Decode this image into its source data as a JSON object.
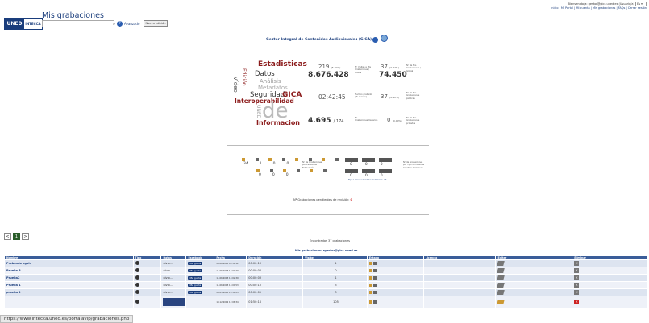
{
  "header": {
    "logo_uned": "UNED",
    "logo_intecca": "INTECCA",
    "app_title": "Mis grabaciones",
    "search_placeholder": "",
    "advanced_label": "Avanzado",
    "new_recording_label": "Nueva edición",
    "welcome": "Bienvenido/a: gestor@gicc.uned.es (Usuario/a)",
    "lang": "Es",
    "nav": "Inicio | Mi Portal | Mi cuenta | Mis grabaciones | FAQs | Cerrar sesión"
  },
  "gica": {
    "title": "Gestor Integral de Contenidos Audiovisuales (GICA)"
  },
  "cloud": [
    {
      "text": "Estadisticas",
      "color": "#8b1a1a"
    },
    {
      "text": "Datos",
      "color": "#333"
    },
    {
      "text": "Análisis",
      "color": "#999"
    },
    {
      "text": "Metadatos",
      "color": "#aaa"
    },
    {
      "text": "Seguridad",
      "color": "#333"
    },
    {
      "text": "GICA",
      "color": "#8b1a1a"
    },
    {
      "text": "Interoperabilidad",
      "color": "#8b1a1a"
    },
    {
      "text": "de",
      "color": "#bbb"
    },
    {
      "text": "Informacion",
      "color": "#8b1a1a"
    },
    {
      "text": "Vídeo",
      "color": "#555"
    },
    {
      "text": "Edición",
      "color": "#8b1a1a"
    },
    {
      "text": "UNED",
      "color": "#999"
    }
  ],
  "stats": {
    "s1": {
      "value": "219",
      "unit": "(5.20%)",
      "label": "Nº Visitas a Mis Grabaciones / Global"
    },
    "s2": {
      "value": "8.676.428",
      "label": ""
    },
    "s3": {
      "value": "37",
      "unit": "(0.42%)",
      "label": "Nº de Mis Grabaciones / Global"
    },
    "s4": {
      "value": "74.450",
      "label": ""
    },
    "s5": {
      "value": "02:42:45",
      "label": "Tiempo grabado (Mi cuenta)"
    },
    "s6": {
      "value": "37",
      "unit": "(0.42%)",
      "label": "Nº de Mis Grabaciones públicas"
    },
    "s7": {
      "value": "4.695",
      "unit": "/ 174",
      "label": "Nº Grabaciones/Usuarios"
    },
    "s8": {
      "value": "0",
      "unit": "(0.00%)",
      "label": "Nº de Mis Grabaciones privadas"
    }
  },
  "states": {
    "row1": [
      "34",
      "1",
      "0",
      "0"
    ],
    "row2": [
      "0",
      "0",
      "0"
    ],
    "label": "Nº de Grabaciones por Estado de Fabricación",
    "cc_row1": [
      "0",
      "0",
      "0"
    ],
    "cc_row2": [
      "0",
      "0",
      "0"
    ],
    "cc_label": "Nº de Grabaciones por Tipo de Licencia Creative Commons",
    "cc_note": "Tipo Licencia Creative Commons: 37",
    "pending": "Nº Grabaciones pendientes de revisión:",
    "pending_value": "0"
  },
  "pager": [
    "<",
    "1",
    ">"
  ],
  "found": "Encontradas 37 grabaciones",
  "mine": "Mis grabaciones: rgestor@gicc.uned.es",
  "table": {
    "headers": [
      "Nombre",
      "Tipo",
      "Datos",
      "Facebook",
      "Fecha",
      "Duración",
      "Visitas",
      "Estado",
      "Licencia",
      "Editar",
      "Eliminar"
    ],
    "rows": [
      {
        "name": "Probando again",
        "datos": "nivlo...",
        "fb": "Me gusta",
        "date": "28.06.2013 09:59:12",
        "dur": "00:00:13",
        "visits": "1"
      },
      {
        "name": "Prueba 3",
        "datos": "nivlo...",
        "fb": "Me gusta",
        "date": "11.06.2013 13:07:49",
        "dur": "00:00:08",
        "visits": "0"
      },
      {
        "name": "Prueba2",
        "datos": "nivlo...",
        "fb": "Me gusta",
        "date": "11.06.2013 13:02:39",
        "dur": "00:00:03",
        "visits": "1"
      },
      {
        "name": "Prueba 1",
        "datos": "nivlo...",
        "fb": "Me gusta",
        "date": "11.06.2013 13:00:53",
        "dur": "00:00:10",
        "visits": "3"
      },
      {
        "name": "prueba 2",
        "datos": "nivlo...",
        "fb": "Me gusta",
        "date": "29.05.2013 15:56:25",
        "dur": "00:00:05",
        "visits": "3"
      },
      {
        "name": "",
        "datos": "",
        "fb": "",
        "date": "10.12.2012 12:06:34",
        "dur": "01:50:16",
        "visits": "105"
      }
    ]
  },
  "statusbar": "https://www.intecca.uned.es/portalavip/grabaciones.php"
}
